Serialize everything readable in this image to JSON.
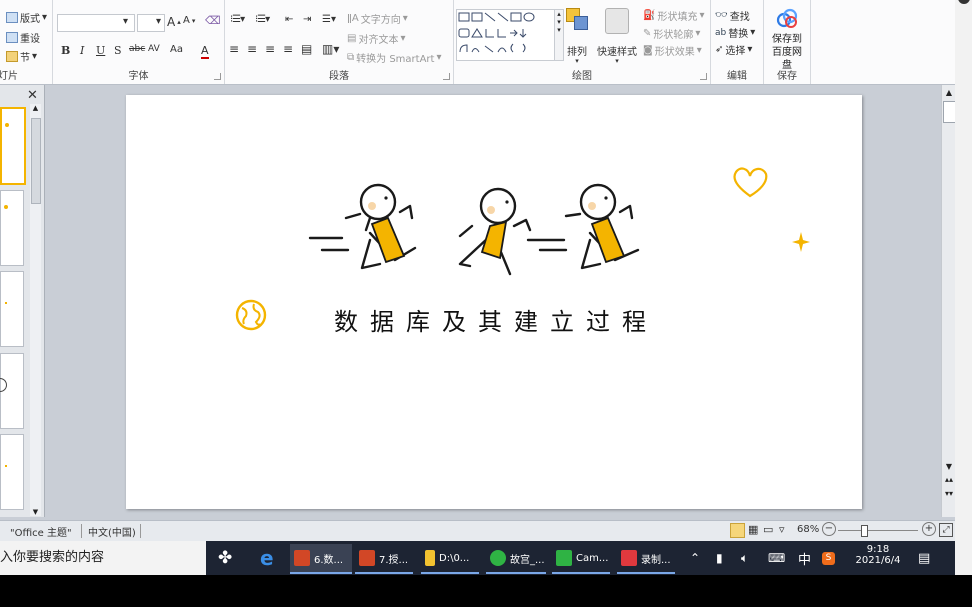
{
  "ribbon": {
    "slides_group": {
      "layout": "版式",
      "reset": "重设",
      "section": "节",
      "label": "灯片"
    },
    "font_group": {
      "label": "字体",
      "bold": "B",
      "italic": "I",
      "underline": "U",
      "strike": "S",
      "abc": "abc",
      "spacing": "AV",
      "case": "Aa",
      "color": "A"
    },
    "paragraph_group": {
      "label": "段落",
      "text_direction": "文字方向",
      "align_text": "对齐文本",
      "smartart": "转换为 SmartArt"
    },
    "drawing_group": {
      "label": "绘图",
      "arrange": "排列",
      "quick_styles": "快速样式",
      "shape_fill": "形状填充",
      "shape_outline": "形状轮廓",
      "shape_effects": "形状效果"
    },
    "editing_group": {
      "label": "编辑",
      "find": "查找",
      "replace": "替换",
      "select": "选择"
    },
    "save_group": {
      "label": "保存",
      "save_baidu": "保存到百度网盘"
    }
  },
  "slide": {
    "title": "数据库及其建立过程"
  },
  "status": {
    "theme": "\"Office 主题\"",
    "language": "中文(中国)",
    "zoom": "68%"
  },
  "taskbar": {
    "search_placeholder": "入你要搜索的内容",
    "apps": [
      {
        "label": "6.数...",
        "color": "#d24726"
      },
      {
        "label": "7.授...",
        "color": "#d24726"
      },
      {
        "label": "D:\\0...",
        "color": "#f2c230"
      },
      {
        "label": "故宫_...",
        "color": "#2fb344"
      },
      {
        "label": "Cam...",
        "color": "#2fb344"
      },
      {
        "label": "录制...",
        "color": "#e0393e"
      }
    ],
    "ime": "中",
    "time": "9:18",
    "date": "2021/6/4"
  },
  "colors": {
    "accent_yellow": "#f4b400",
    "taskbar": "#1d2433"
  }
}
